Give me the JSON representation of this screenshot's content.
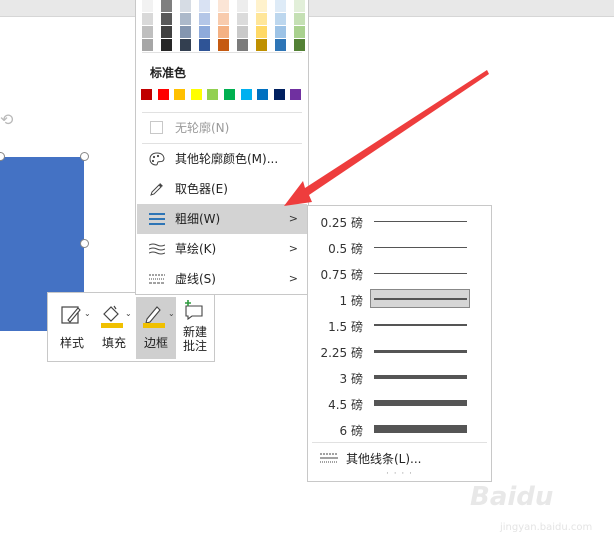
{
  "tone_columns": [
    [
      "#f2f2f2",
      "#d9d9d9",
      "#bfbfbf",
      "#a6a6a6"
    ],
    [
      "#7f7f7f",
      "#595959",
      "#404040",
      "#262626"
    ],
    [
      "#d6dce4",
      "#acb9ca",
      "#8496b0",
      "#333f50"
    ],
    [
      "#d9e2f3",
      "#b4c6e7",
      "#8eaadb",
      "#2f5496"
    ],
    [
      "#fbe5d6",
      "#f8cbad",
      "#f4b183",
      "#c55a11"
    ],
    [
      "#ededed",
      "#dbdbdb",
      "#c9c9c9",
      "#7b7b7b"
    ],
    [
      "#fff2cc",
      "#ffe699",
      "#ffd966",
      "#bf9000"
    ],
    [
      "#deebf7",
      "#bdd7ee",
      "#9dc3e6",
      "#2e75b6"
    ],
    [
      "#e2efd9",
      "#c5e0b4",
      "#a9d18e",
      "#538135"
    ]
  ],
  "menu": {
    "standard_label": "标准色",
    "standard_colors": [
      "#c00000",
      "#ff0000",
      "#ffc000",
      "#ffff00",
      "#92d050",
      "#00b050",
      "#00b0f0",
      "#0070c0",
      "#002060",
      "#7030a0"
    ],
    "no_outline": "无轮廓(N)",
    "more_colors": "其他轮廓颜色(M)...",
    "eyedropper": "取色器(E)",
    "weight": "粗细(W)",
    "sketch": "草绘(K)",
    "dash": "虚线(S)"
  },
  "weights": [
    {
      "label": "0.25 磅",
      "thickness": 1
    },
    {
      "label": "0.5 磅",
      "thickness": 1
    },
    {
      "label": "0.75 磅",
      "thickness": 1
    },
    {
      "label": "1 磅",
      "thickness": 2,
      "selected": true
    },
    {
      "label": "1.5 磅",
      "thickness": 2
    },
    {
      "label": "2.25 磅",
      "thickness": 3
    },
    {
      "label": "3 磅",
      "thickness": 4
    },
    {
      "label": "4.5 磅",
      "thickness": 6
    },
    {
      "label": "6 磅",
      "thickness": 8
    }
  ],
  "more_lines": "其他线条(L)...",
  "toolbar": {
    "style": "样式",
    "fill": "填充",
    "border": "边框",
    "new_comment_1": "新建",
    "new_comment_2": "批注"
  },
  "colors": {
    "shape": "#4472c4",
    "highlight": "#d3d3d3",
    "arrow": "#ee3d3d",
    "fill_bar": "#f0c000"
  }
}
